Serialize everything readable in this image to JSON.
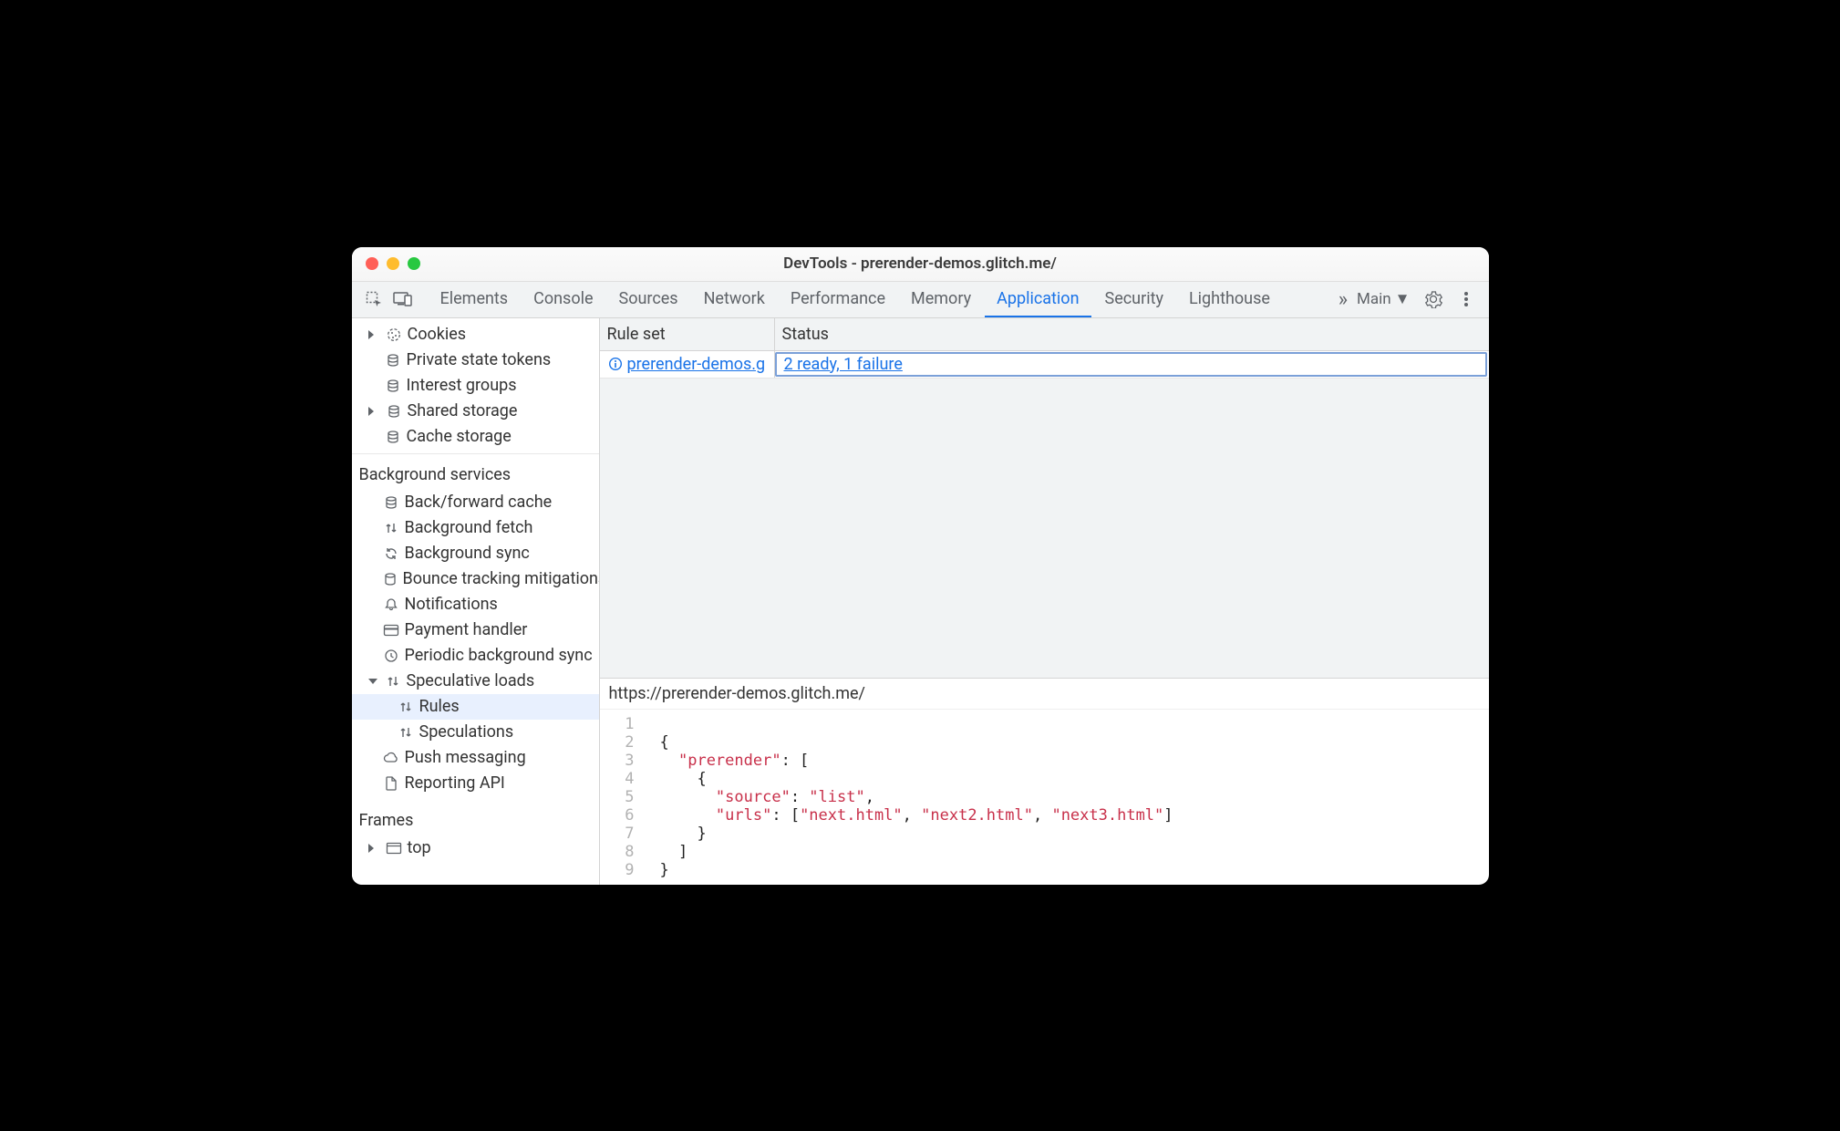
{
  "window": {
    "title": "DevTools - prerender-demos.glitch.me/"
  },
  "tabs": {
    "elements": "Elements",
    "console": "Console",
    "sources": "Sources",
    "network": "Network",
    "performance": "Performance",
    "memory": "Memory",
    "application": "Application",
    "security": "Security",
    "lighthouse": "Lighthouse"
  },
  "toolbar": {
    "target": "Main"
  },
  "sidebar": {
    "storage": {
      "cookies": "Cookies",
      "private_state_tokens": "Private state tokens",
      "interest_groups": "Interest groups",
      "shared_storage": "Shared storage",
      "cache_storage": "Cache storage"
    },
    "background_services": {
      "title": "Background services",
      "back_forward_cache": "Back/forward cache",
      "background_fetch": "Background fetch",
      "background_sync": "Background sync",
      "bounce_tracking": "Bounce tracking mitigations",
      "notifications": "Notifications",
      "payment_handler": "Payment handler",
      "periodic_bg_sync": "Periodic background sync",
      "speculative_loads": "Speculative loads",
      "rules": "Rules",
      "speculations": "Speculations",
      "push_messaging": "Push messaging",
      "reporting_api": "Reporting API"
    },
    "frames": {
      "title": "Frames",
      "top": "top"
    }
  },
  "grid": {
    "header": {
      "ruleset": "Rule set",
      "status": "Status"
    },
    "row": {
      "ruleset": "prerender-demos.g",
      "status": "2 ready, 1 failure"
    }
  },
  "detail": {
    "url": "https://prerender-demos.glitch.me/",
    "code": {
      "line_numbers": [
        "1",
        "2",
        "3",
        "4",
        "5",
        "6",
        "7",
        "8",
        "9"
      ],
      "k_prerender": "\"prerender\"",
      "k_source": "\"source\"",
      "v_list": "\"list\"",
      "k_urls": "\"urls\"",
      "v_u1": "\"next.html\"",
      "v_u2": "\"next2.html\"",
      "v_u3": "\"next3.html\""
    }
  }
}
